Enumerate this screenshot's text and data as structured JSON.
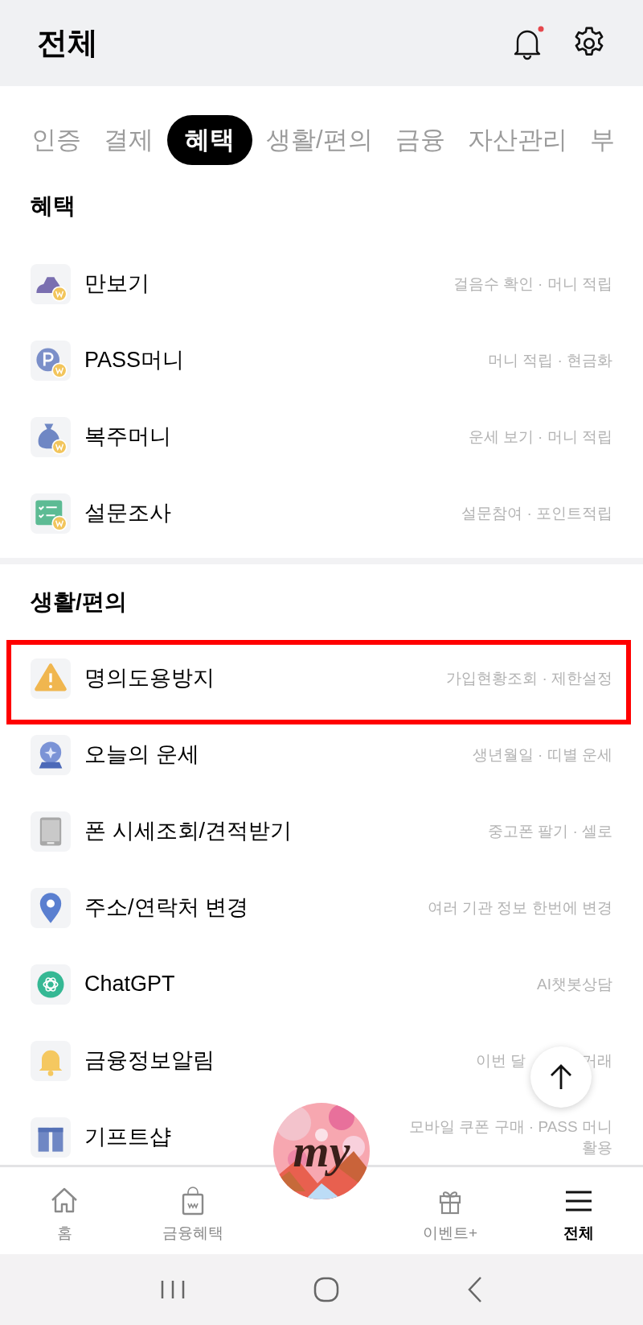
{
  "header": {
    "title": "전체",
    "notification_dot": true
  },
  "tabs": [
    {
      "label": "인증",
      "selected": false
    },
    {
      "label": "결제",
      "selected": false
    },
    {
      "label": "혜택",
      "selected": true
    },
    {
      "label": "생활/편의",
      "selected": false
    },
    {
      "label": "금융",
      "selected": false
    },
    {
      "label": "자산관리",
      "selected": false
    },
    {
      "label": "부",
      "selected": false
    }
  ],
  "sections": [
    {
      "title": "혜택",
      "items": [
        {
          "title": "만보기",
          "subtitle": [
            "걸음수 확인 · 머니 적립"
          ],
          "highlighted": false
        },
        {
          "title": "PASS머니",
          "subtitle": [
            "머니 적립 · 현금화"
          ],
          "highlighted": false
        },
        {
          "title": "복주머니",
          "subtitle": [
            "운세 보기 · 머니 적립"
          ],
          "highlighted": false
        },
        {
          "title": "설문조사",
          "subtitle": [
            "설문참여 · 포인트적립"
          ],
          "highlighted": false
        }
      ]
    },
    {
      "title": "생활/편의",
      "items": [
        {
          "title": "명의도용방지",
          "subtitle": [
            "가입현황조회 · 제한설정"
          ],
          "highlighted": true
        },
        {
          "title": "오늘의 운세",
          "subtitle": [
            "생년월일 · 띠별 운세"
          ],
          "highlighted": false
        },
        {
          "title": "폰 시세조회/견적받기",
          "subtitle": [
            "중고폰 팔기 · 셀로"
          ],
          "highlighted": false
        },
        {
          "title": "주소/연락처 변경",
          "subtitle": [
            "여러 기관 정보 한번에 변경"
          ],
          "highlighted": false
        },
        {
          "title": "ChatGPT",
          "subtitle": [
            "AI챗봇상담"
          ],
          "highlighted": false
        },
        {
          "title": "금융정보알림",
          "subtitle": [
            "이번 달",
            "거래"
          ],
          "highlighted": false
        },
        {
          "title": "기프트샵",
          "subtitle": [
            "모바일 쿠폰 구매 · PASS 머니 활용"
          ],
          "highlighted": false
        }
      ]
    }
  ],
  "bottom_nav": [
    {
      "kind": "tab",
      "label": "홈",
      "selected": false
    },
    {
      "kind": "tab",
      "label": "금융혜택",
      "selected": false
    },
    {
      "kind": "logo",
      "label": "my",
      "selected": false
    },
    {
      "kind": "tab",
      "label": "이벤트+",
      "selected": false
    },
    {
      "kind": "tab",
      "label": "전체",
      "selected": true
    }
  ]
}
